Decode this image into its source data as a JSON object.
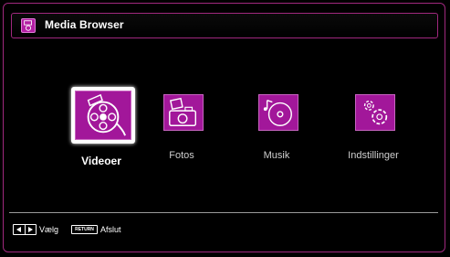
{
  "header": {
    "title": "Media Browser",
    "icon": "media-browser-icon"
  },
  "menu": {
    "items": [
      {
        "label": "Videoer",
        "icon": "film-reel-icon",
        "selected": true
      },
      {
        "label": "Fotos",
        "icon": "photo-camera-icon",
        "selected": false
      },
      {
        "label": "Musik",
        "icon": "music-disc-icon",
        "selected": false
      },
      {
        "label": "Indstillinger",
        "icon": "settings-gears-icon",
        "selected": false
      }
    ]
  },
  "footer": {
    "navigate_label": "Vælg",
    "return_key_text": "RETURN",
    "exit_label": "Afslut"
  },
  "colors": {
    "accent": "#a2179a",
    "frame": "#a0287e"
  }
}
